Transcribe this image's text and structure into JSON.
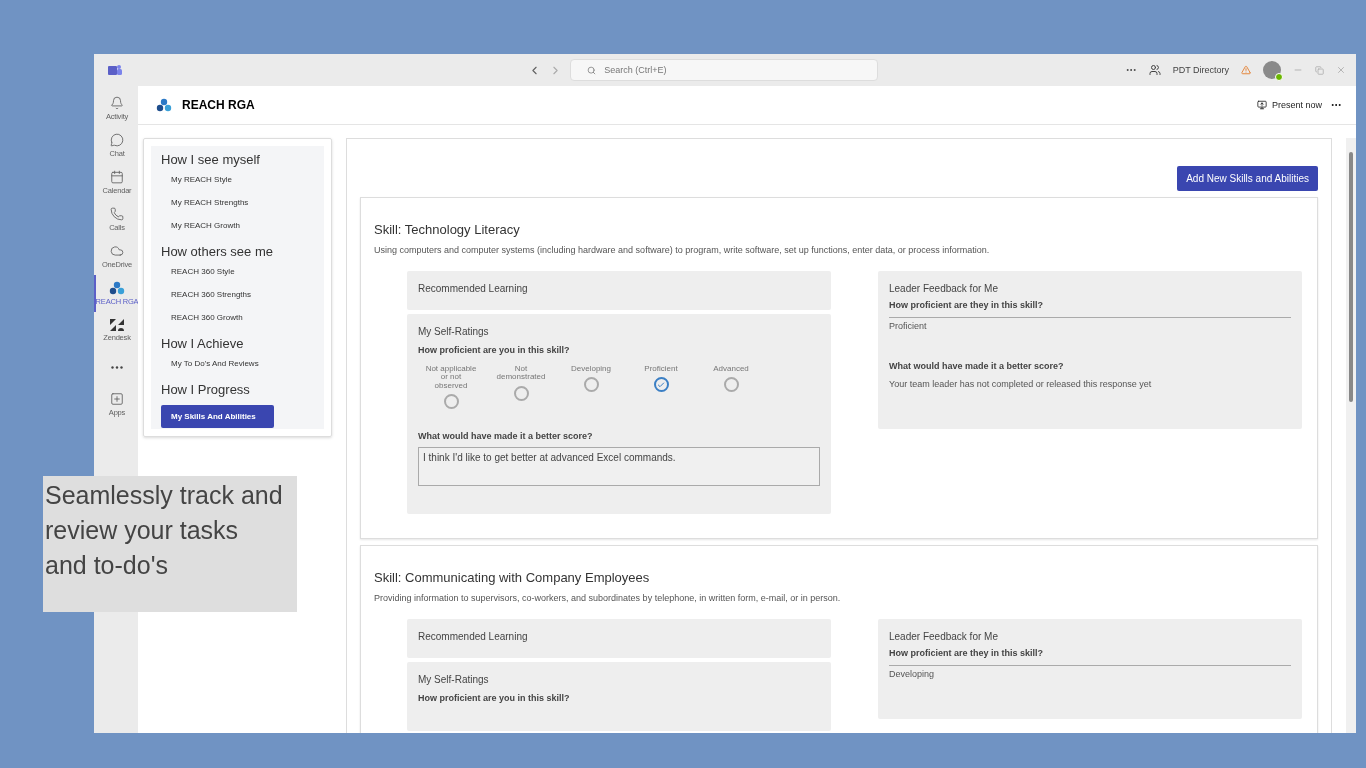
{
  "window": {
    "search": {
      "placeholder": "Search (Ctrl+E)"
    },
    "org": "PDT Directory"
  },
  "rail": [
    {
      "kind": "bell",
      "label": "Activity",
      "selected": false
    },
    {
      "kind": "chat",
      "label": "Chat",
      "selected": false
    },
    {
      "kind": "calendar",
      "label": "Calendar",
      "selected": false
    },
    {
      "kind": "phone",
      "label": "Calls",
      "selected": false
    },
    {
      "kind": "cloud",
      "label": "OneDrive",
      "selected": false
    },
    {
      "kind": "reach",
      "label": "REACH RGA",
      "selected": true
    },
    {
      "kind": "zendesk",
      "label": "Zendesk",
      "selected": false
    },
    {
      "kind": "more",
      "selected": false
    },
    {
      "kind": "apps",
      "label": "Apps",
      "selected": false
    }
  ],
  "app": {
    "title": "REACH RGA",
    "present": "Present now"
  },
  "nav": [
    {
      "heading": "How I see myself",
      "items": [
        {
          "label": "My REACH Style",
          "selected": false
        },
        {
          "label": "My REACH Strengths",
          "selected": false
        },
        {
          "label": "My REACH Growth",
          "selected": false
        }
      ]
    },
    {
      "heading": "How others see me",
      "items": [
        {
          "label": "REACH 360 Style",
          "selected": false
        },
        {
          "label": "REACH 360 Strengths",
          "selected": false
        },
        {
          "label": "REACH 360 Growth",
          "selected": false
        }
      ]
    },
    {
      "heading": "How I Achieve",
      "items": [
        {
          "label": "My To Do's And Reviews",
          "selected": false
        }
      ]
    },
    {
      "heading": "How I Progress",
      "items": [
        {
          "label": "My Skills And Abilities",
          "selected": true
        }
      ]
    }
  ],
  "add_button": "Add New Skills and Abilities",
  "skills": [
    {
      "title": "Skill: Technology Literacy",
      "description": "Using computers and computer systems (including hardware and software) to program, write software, set up functions, enter data, or process information.",
      "recommended": "Recommended Learning",
      "self": {
        "title": "My Self-Ratings",
        "question": "How proficient are you in this skill?",
        "options": [
          {
            "label": "Not applicable or not observed",
            "selected": false
          },
          {
            "label": "Not demonstrated",
            "selected": false
          },
          {
            "label": "Developing",
            "selected": false
          },
          {
            "label": "Proficient",
            "selected": true
          },
          {
            "label": "Advanced",
            "selected": false
          }
        ],
        "better_label": "What would have made it a better score?",
        "better_value": "I think I'd like to get better at advanced Excel commands."
      },
      "leader": {
        "title": "Leader Feedback for Me",
        "question": "How proficient are they in this skill?",
        "value": "Proficient",
        "better_label": "What would have made it a better score?",
        "better_value": "Your team leader has not completed or released this response yet"
      }
    },
    {
      "title": "Skill: Communicating with Company Employees",
      "description": "Providing information to supervisors, co-workers, and subordinates by telephone, in written form, e-mail, or in person.",
      "recommended": "Recommended Learning",
      "self": {
        "title": "My Self-Ratings",
        "question": "How proficient are you in this skill?"
      },
      "leader": {
        "title": "Leader Feedback for Me",
        "question": "How proficient are they in this skill?",
        "value": "Developing"
      }
    }
  ],
  "caption": "Seamlessly track and review your tasks and to-do's"
}
